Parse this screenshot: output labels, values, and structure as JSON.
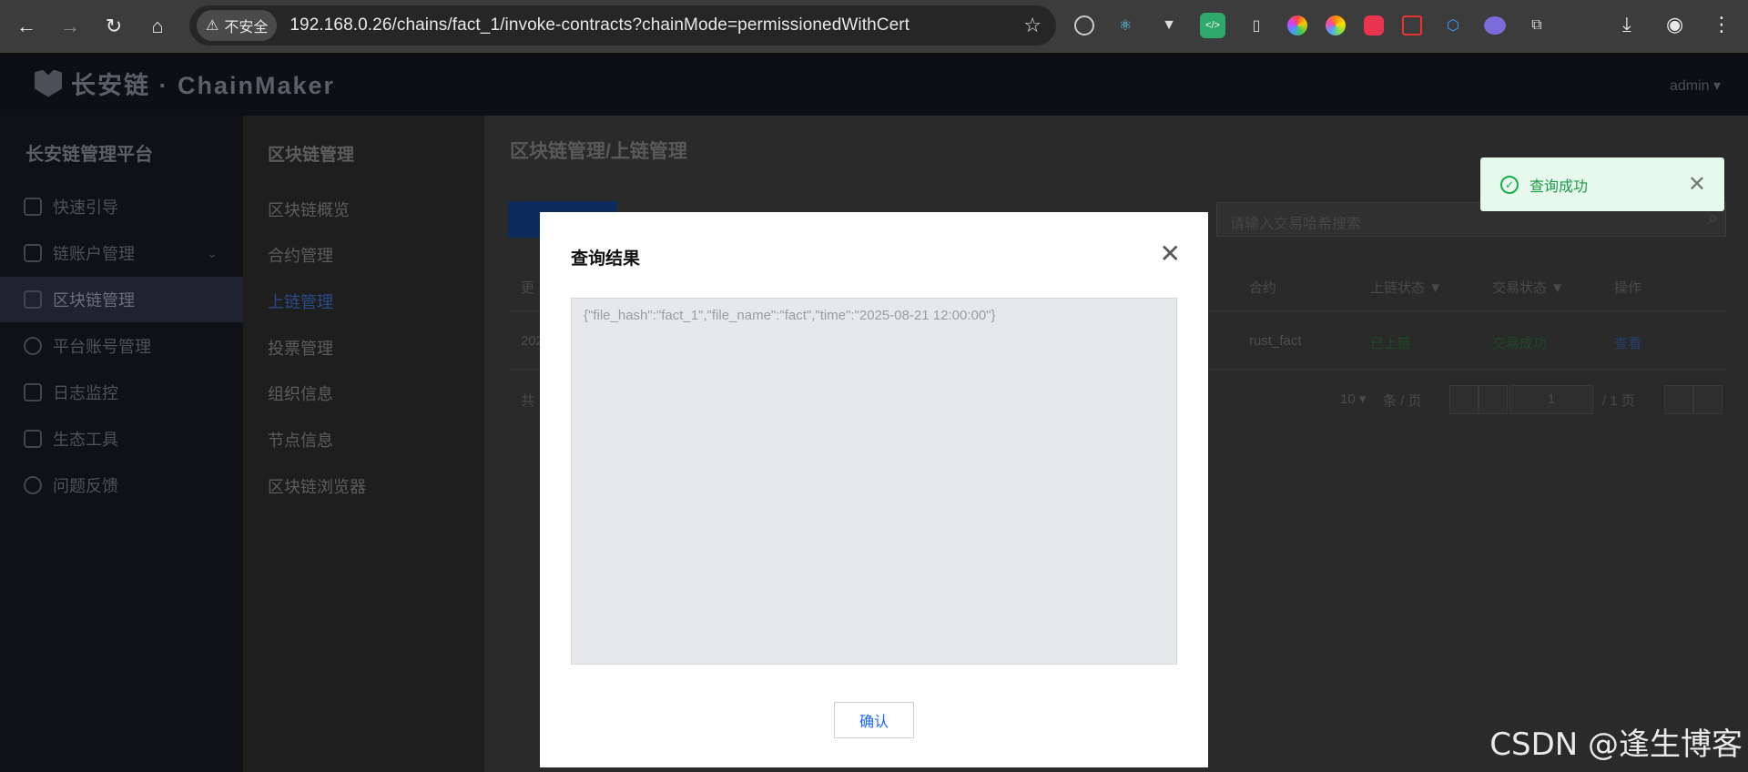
{
  "browser": {
    "security_label": "不安全",
    "url": "192.168.0.26/chains/fact_1/invoke-contracts?chainMode=permissionedWithCert"
  },
  "header": {
    "logo_text": "长安链 · ChainMaker",
    "user": "admin"
  },
  "sidebar": {
    "title": "长安链管理平台",
    "items": [
      {
        "label": "快速引导",
        "icon": "rocket-icon"
      },
      {
        "label": "链账户管理",
        "icon": "account-icon"
      },
      {
        "label": "区块链管理",
        "icon": "blockchain-icon"
      },
      {
        "label": "平台账号管理",
        "icon": "user-icon"
      },
      {
        "label": "日志监控",
        "icon": "monitor-icon"
      },
      {
        "label": "生态工具",
        "icon": "layers-icon"
      },
      {
        "label": "问题反馈",
        "icon": "question-icon"
      }
    ]
  },
  "submenu": {
    "title": "区块链管理",
    "items": [
      "区块链概览",
      "合约管理",
      "上链管理",
      "投票管理",
      "组织信息",
      "节点信息",
      "区块链浏览器"
    ]
  },
  "main": {
    "breadcrumb": "区块链管理/上链管理",
    "search_placeholder": "请输入交易哈希搜索",
    "columns": {
      "c1": "更",
      "contract": "合约",
      "chain_status": "上链状态",
      "tx_status": "交易状态",
      "ops": "操作"
    },
    "row": {
      "c1": "202",
      "contract": "rust_fact",
      "chain_status": "已上链",
      "tx_status": "交易成功",
      "op": "查看"
    },
    "pagination": {
      "total_prefix": "共",
      "page_size": "10",
      "per_page": "条 / 页",
      "current_page": "1",
      "page_total": "/ 1 页"
    }
  },
  "toast": {
    "text": "查询成功"
  },
  "dialog": {
    "title": "查询结果",
    "content": "{\"file_hash\":\"fact_1\",\"file_name\":\"fact\",\"time\":\"2025-08-21 12:00:00\"}",
    "confirm": "确认"
  },
  "watermark": "CSDN @逢生博客"
}
